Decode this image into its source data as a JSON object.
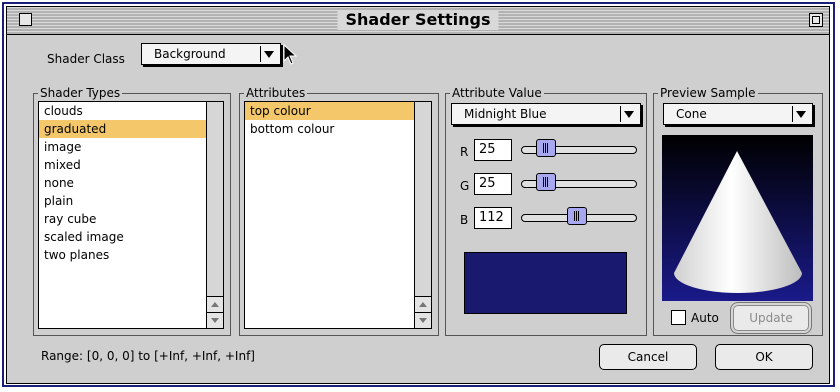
{
  "window": {
    "title": "Shader Settings"
  },
  "shader_class": {
    "label": "Shader Class",
    "value": "Background"
  },
  "shader_types": {
    "title": "Shader Types",
    "items": [
      "clouds",
      "graduated",
      "image",
      "mixed",
      "none",
      "plain",
      "ray cube",
      "scaled image",
      "two planes"
    ],
    "selected": "graduated"
  },
  "attributes": {
    "title": "Attributes",
    "items": [
      "top colour",
      "bottom colour"
    ],
    "selected": "top colour"
  },
  "attribute_value": {
    "title": "Attribute Value",
    "color_name": "Midnight Blue",
    "r": {
      "label": "R",
      "value": "25",
      "level": 25
    },
    "g": {
      "label": "G",
      "value": "25",
      "level": 25
    },
    "b": {
      "label": "B",
      "value": "112",
      "level": 112
    },
    "max": 255,
    "swatch_color": "#191970"
  },
  "preview": {
    "title": "Preview Sample",
    "shape": "Cone",
    "auto_label": "Auto",
    "update_label": "Update"
  },
  "footer": {
    "range_text": "Range: [0, 0, 0] to [+Inf, +Inf, +Inf]",
    "cancel_label": "Cancel",
    "ok_label": "OK"
  },
  "colors": {
    "selection": "#f4c86a",
    "window_bg": "#cfcfd0",
    "frame_border": "#1c1f7a"
  }
}
